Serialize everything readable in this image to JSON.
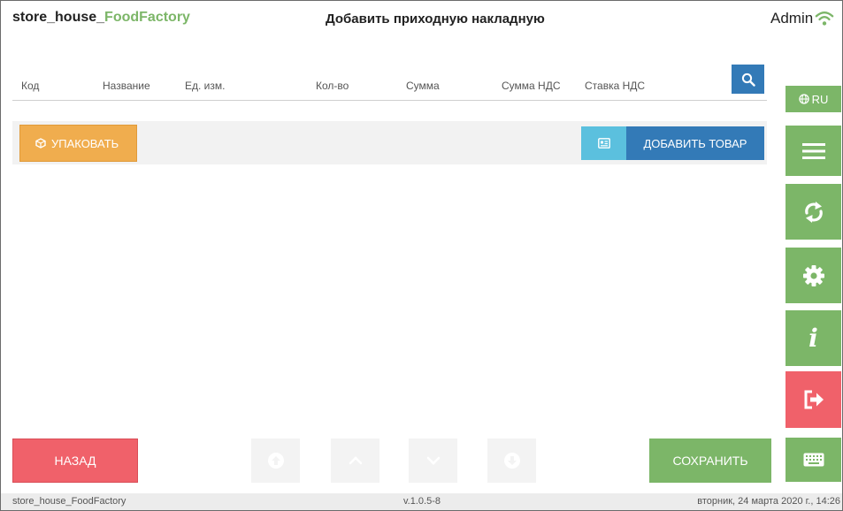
{
  "header": {
    "app_name_prefix": "store_house_",
    "app_name_accent": "FoodFactory",
    "page_title": "Добавить приходную накладную",
    "user": "Admin"
  },
  "table": {
    "columns": [
      "Код",
      "Название",
      "Ед. изм.",
      "Кол-во",
      "Сумма",
      "Сумма НДС",
      "Ставка НДС"
    ]
  },
  "toolbar": {
    "pack_label": "УПАКОВАТЬ",
    "add_item_label": "ДОБАВИТЬ ТОВАР"
  },
  "sidebar": {
    "language": "RU"
  },
  "footer": {
    "back_label": "НАЗАД",
    "save_label": "СОХРАНИТЬ"
  },
  "statusbar": {
    "app": "store_house_FoodFactory",
    "version": "v.1.0.5-8",
    "datetime": "вторник, 24 марта 2020 г., 14:26"
  },
  "colors": {
    "accent_green": "#7cb668",
    "primary_blue": "#337ab7",
    "info_blue": "#5bc0de",
    "warning_orange": "#f0ad4e",
    "danger_red": "#f0616a"
  },
  "icons": [
    "wifi-icon",
    "search-icon",
    "box-icon",
    "id-card-icon",
    "globe-icon",
    "hamburger-icon",
    "sync-icon",
    "gear-icon",
    "info-icon",
    "logout-icon",
    "keyboard-icon",
    "arrow-circle-up-icon",
    "chevron-up-icon",
    "chevron-down-icon",
    "arrow-circle-down-icon"
  ]
}
